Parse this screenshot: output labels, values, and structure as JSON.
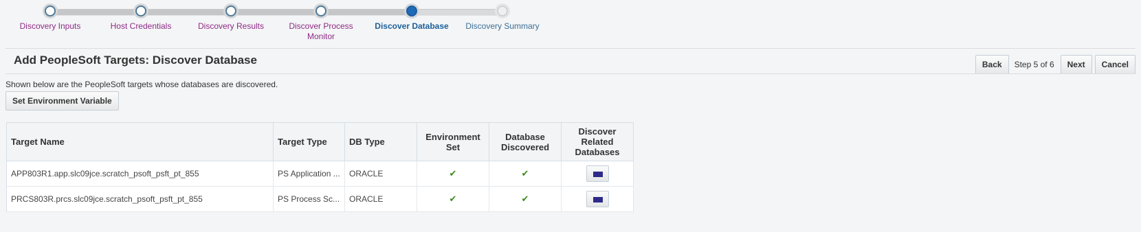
{
  "train": {
    "steps": [
      {
        "label": "Discovery Inputs",
        "state": "visited"
      },
      {
        "label": "Host Credentials",
        "state": "visited"
      },
      {
        "label": "Discovery Results",
        "state": "visited"
      },
      {
        "label": "Discover Process Monitor",
        "state": "visited"
      },
      {
        "label": "Discover Database",
        "state": "current"
      },
      {
        "label": "Discovery Summary",
        "state": "future"
      }
    ]
  },
  "header": {
    "title": "Add PeopleSoft Targets: Discover Database",
    "back_label": "Back",
    "step_text": "Step 5 of 6",
    "next_label": "Next",
    "cancel_label": "Cancel"
  },
  "description": "Shown below are the PeopleSoft targets whose databases are discovered.",
  "set_env_label": "Set Environment Variable",
  "table": {
    "columns": {
      "target_name": "Target Name",
      "target_type": "Target Type",
      "db_type": "DB Type",
      "environment_set": "Environment Set",
      "database_discovered": "Database Discovered",
      "discover_related": "Discover Related Databases"
    },
    "rows": [
      {
        "target_name": "APP803R1.app.slc09jce.scratch_psoft_psft_pt_855",
        "target_type": "PS Application ...",
        "db_type": "ORACLE",
        "environment_set": "✔",
        "database_discovered": "✔"
      },
      {
        "target_name": "PRCS803R.prcs.slc09jce.scratch_psoft_psft_pt_855",
        "target_type": "PS Process Sc...",
        "db_type": "ORACLE",
        "environment_set": "✔",
        "database_discovered": "✔"
      }
    ]
  },
  "icons": {
    "check": "checkmark-icon",
    "discover": "discover-databases-icon"
  },
  "colors": {
    "visited_link": "#8d2a86",
    "current_step": "#1b5f9a",
    "check": "#3a8a1e",
    "icon_fill": "#2e2a8a"
  }
}
